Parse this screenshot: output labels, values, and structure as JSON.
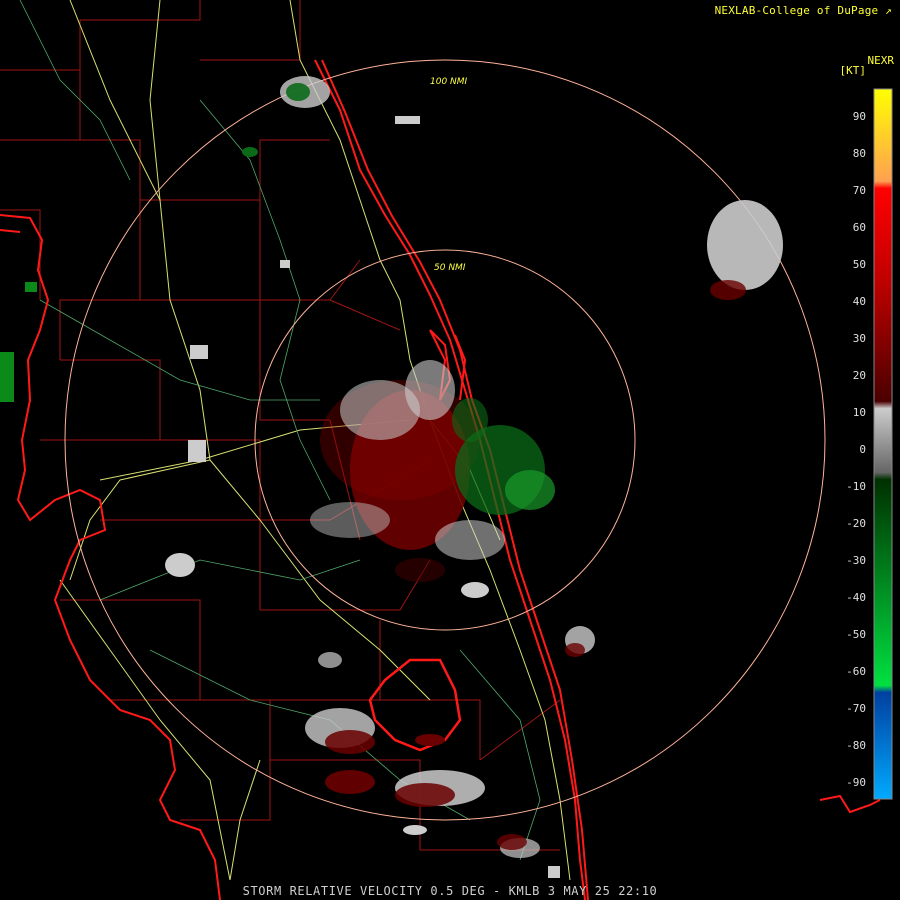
{
  "header": {
    "credit": "NEXLAB-College of DuPage",
    "product_code": "NEXR",
    "unit": "[KT]"
  },
  "footer": {
    "caption": "STORM RELATIVE VELOCITY 0.5 DEG - KMLB 3 MAY 25 22:10"
  },
  "radar": {
    "site": "KMLB",
    "product": "STORM RELATIVE VELOCITY",
    "tilt_deg": 0.5,
    "range_rings": [
      "50 NMI",
      "100 NMI"
    ]
  },
  "colorbar": {
    "unit": "KT",
    "ticks": [
      "90",
      "80",
      "70",
      "60",
      "50",
      "40",
      "30",
      "20",
      "10",
      "0",
      "-10",
      "-20",
      "-30",
      "-40",
      "-50",
      "-60",
      "-70",
      "-80",
      "-90"
    ],
    "colors": {
      "top": "#ffff00",
      "orange": "#ffa060",
      "red": "#ff0000",
      "dark_red": "#800000",
      "gray": "#c8c8c8",
      "dark_green": "#005a00",
      "green": "#00e040",
      "blue": "#0050c0",
      "light_blue": "#0af"
    }
  },
  "map_colors": {
    "coast": "#ff1a1a",
    "county": "#b01818",
    "road": "#d8e070",
    "ring": "#ffb49a"
  }
}
